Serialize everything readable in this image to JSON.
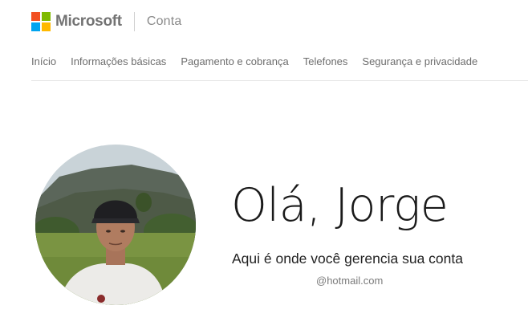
{
  "header": {
    "brand": "Microsoft",
    "section": "Conta",
    "logo_colors": [
      "#f25022",
      "#7fba00",
      "#00a4ef",
      "#ffb900"
    ]
  },
  "nav": {
    "items": [
      {
        "label": "Início"
      },
      {
        "label": "Informações básicas"
      },
      {
        "label": "Pagamento e cobrança"
      },
      {
        "label": "Telefones"
      },
      {
        "label": "Segurança e privacidade"
      }
    ]
  },
  "profile": {
    "greeting": "Olá, Jorge",
    "subtitle": "Aqui é onde você gerencia sua conta",
    "email": "@hotmail.com"
  }
}
